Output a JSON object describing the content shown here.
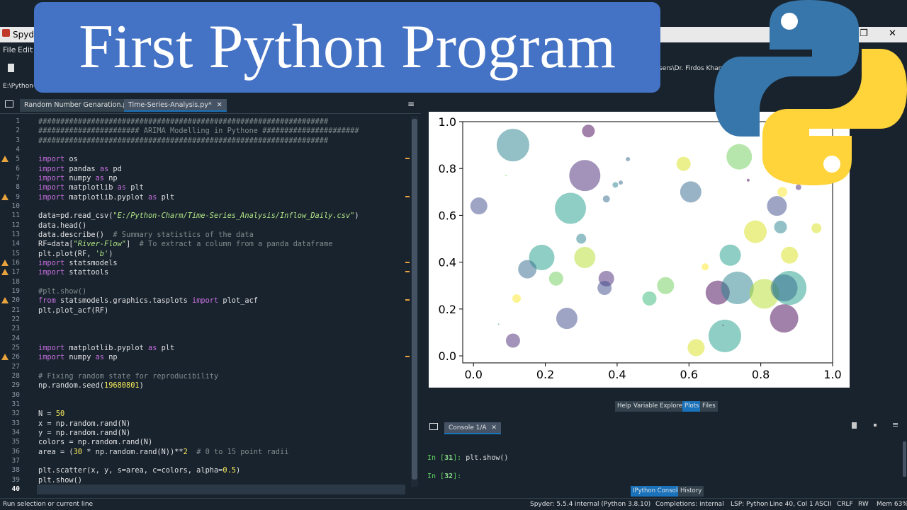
{
  "banner": {
    "title": "First Python Program"
  },
  "window": {
    "title": "Spyder",
    "minimize": "—",
    "maximize": "❐",
    "close": "✕"
  },
  "menu": {
    "items": [
      "File",
      "Edit"
    ]
  },
  "toolbar": {
    "path": "E:\\Python-C",
    "user_path": "sers\\Dr. Firdos Khan"
  },
  "editor": {
    "tabs": [
      {
        "label": "Random Number Genaration.py",
        "close": "✕"
      },
      {
        "label": "Time-Series-Analysis.py*",
        "close": "✕"
      }
    ],
    "options_icon": "≡",
    "current_line": 40,
    "warning_lines": [
      5,
      9,
      16,
      17,
      20,
      26
    ],
    "lines": [
      [
        [
          "cm",
          "##################################################################"
        ]
      ],
      [
        [
          "cm",
          "####################### ARIMA Modelling in Pythone ######################"
        ]
      ],
      [
        [
          "cm",
          "##################################################################"
        ]
      ],
      [],
      [
        [
          "kw",
          "import"
        ],
        [
          "",
          " os"
        ]
      ],
      [
        [
          "kw",
          "import"
        ],
        [
          "",
          " pandas "
        ],
        [
          "kw",
          "as"
        ],
        [
          "",
          " pd"
        ]
      ],
      [
        [
          "kw",
          "import"
        ],
        [
          "",
          " numpy "
        ],
        [
          "kw",
          "as"
        ],
        [
          "",
          " np"
        ]
      ],
      [
        [
          "kw",
          "import"
        ],
        [
          "",
          " matplotlib "
        ],
        [
          "kw",
          "as"
        ],
        [
          "",
          " plt"
        ]
      ],
      [
        [
          "kw",
          "import"
        ],
        [
          "",
          " matplotlib.pyplot "
        ],
        [
          "kw",
          "as"
        ],
        [
          "",
          " plt"
        ]
      ],
      [],
      [
        [
          "",
          "data=pd.read_csv("
        ],
        [
          "st",
          "\"E:/Python-Charm/Time-Series_Analysis/Inflow_Daily.csv\""
        ],
        [
          "",
          ")"
        ]
      ],
      [
        [
          "",
          "data.head()"
        ]
      ],
      [
        [
          "",
          "data.describe()  "
        ],
        [
          "cm",
          "# Summary statistics of the data"
        ]
      ],
      [
        [
          "",
          "RF=data["
        ],
        [
          "st",
          "\"River-Flow\""
        ],
        [
          "",
          "]  "
        ],
        [
          "cm",
          "# To extract a column from a panda dataframe"
        ]
      ],
      [
        [
          "",
          "plt.plot(RF, "
        ],
        [
          "st",
          "'b'"
        ],
        [
          "",
          ")"
        ]
      ],
      [
        [
          "kw",
          "import"
        ],
        [
          "",
          " statsmodels"
        ]
      ],
      [
        [
          "kw",
          "import"
        ],
        [
          "",
          " stattools"
        ]
      ],
      [],
      [
        [
          "cm",
          "#plt.show()"
        ]
      ],
      [
        [
          "kw",
          "from"
        ],
        [
          "",
          " statsmodels.graphics.tasplots "
        ],
        [
          "kw",
          "import"
        ],
        [
          "",
          " plot_acf"
        ]
      ],
      [
        [
          "",
          "plt.plot_acf(RF)"
        ]
      ],
      [],
      [],
      [],
      [
        [
          "kw",
          "import"
        ],
        [
          "",
          " matplotlib.pyplot "
        ],
        [
          "kw",
          "as"
        ],
        [
          "",
          " plt"
        ]
      ],
      [
        [
          "kw",
          "import"
        ],
        [
          "",
          " numpy "
        ],
        [
          "kw",
          "as"
        ],
        [
          "",
          " np"
        ]
      ],
      [],
      [
        [
          "cm",
          "# Fixing random state for reproducibility"
        ]
      ],
      [
        [
          "",
          "np.random.seed("
        ],
        [
          "num",
          "19680801"
        ],
        [
          "",
          ")"
        ]
      ],
      [],
      [],
      [
        [
          "",
          "N = "
        ],
        [
          "num",
          "50"
        ]
      ],
      [
        [
          "",
          "x = np.random.rand(N)"
        ]
      ],
      [
        [
          "",
          "y = np.random.rand(N)"
        ]
      ],
      [
        [
          "",
          "colors = np.random.rand(N)"
        ]
      ],
      [
        [
          "",
          "area = ("
        ],
        [
          "num",
          "30"
        ],
        [
          "",
          " * np.random.rand(N))**"
        ],
        [
          "num",
          "2"
        ],
        [
          "",
          "  "
        ],
        [
          "cm",
          "# 0 to 15 point radii"
        ]
      ],
      [],
      [
        [
          "",
          "plt.scatter(x, y, s=area, c=colors, alpha="
        ],
        [
          "num",
          "0.5"
        ],
        [
          "",
          ")"
        ]
      ],
      [
        [
          "",
          "plt.show()"
        ]
      ],
      []
    ]
  },
  "plots_pane": {
    "tabs": [
      "Help",
      "Variable Explorer",
      "Plots",
      "Files"
    ],
    "active_tab": "Plots"
  },
  "console": {
    "tab_label": "Console 1/A",
    "tab_close": "✕",
    "prompts": [
      {
        "prefix": "In [",
        "num": "31",
        "suffix": "]:",
        "code": " plt.show()"
      },
      {
        "prefix": "In [",
        "num": "32",
        "suffix": "]:",
        "code": ""
      }
    ],
    "tabs": [
      "IPython Console",
      "History"
    ]
  },
  "statusbar": {
    "left": "Run selection or current line",
    "items": [
      "Spyder: 5.5.4",
      "internal (Python 3.8.10)",
      "Completions: internal",
      "LSP: Python",
      "Line 40, Col 1",
      "ASCII",
      "CRLF",
      "RW",
      "Mem 63%"
    ]
  },
  "colors": {
    "bg": "#19232d",
    "banner": "#4472c4",
    "logo_blue": "#3776ab",
    "logo_yellow": "#ffd43b",
    "accent": "#1a72bb"
  },
  "chart_data": {
    "type": "scatter",
    "xlim": [
      -0.03,
      1.0
    ],
    "ylim": [
      -0.03,
      1.0
    ],
    "xticks": [
      "0.0",
      "0.2",
      "0.4",
      "0.6",
      "0.8",
      "1.0"
    ],
    "yticks": [
      "0.0",
      "0.2",
      "0.4",
      "0.6",
      "0.8",
      "1.0"
    ],
    "grid": false,
    "points": [
      {
        "x": 0.11,
        "y": 0.9,
        "r": 23,
        "color": "#26828e"
      },
      {
        "x": 0.32,
        "y": 0.96,
        "r": 9,
        "color": "#440154"
      },
      {
        "x": 0.31,
        "y": 0.77,
        "r": 22,
        "color": "#482878"
      },
      {
        "x": 0.015,
        "y": 0.64,
        "r": 12,
        "color": "#3e4a89"
      },
      {
        "x": 0.27,
        "y": 0.63,
        "r": 22,
        "color": "#1f9e89"
      },
      {
        "x": 0.19,
        "y": 0.42,
        "r": 18,
        "color": "#1f9e89"
      },
      {
        "x": 0.15,
        "y": 0.37,
        "r": 13,
        "color": "#31688e"
      },
      {
        "x": 0.3,
        "y": 0.5,
        "r": 7,
        "color": "#26828e"
      },
      {
        "x": 0.31,
        "y": 0.42,
        "r": 15,
        "color": "#b5de2b"
      },
      {
        "x": 0.23,
        "y": 0.33,
        "r": 10,
        "color": "#6ece58"
      },
      {
        "x": 0.37,
        "y": 0.33,
        "r": 11,
        "color": "#482878"
      },
      {
        "x": 0.365,
        "y": 0.29,
        "r": 10,
        "color": "#3e4a89"
      },
      {
        "x": 0.37,
        "y": 0.67,
        "r": 5,
        "color": "#31688e"
      },
      {
        "x": 0.395,
        "y": 0.73,
        "r": 4,
        "color": "#26828e"
      },
      {
        "x": 0.41,
        "y": 0.74,
        "r": 3,
        "color": "#31688e"
      },
      {
        "x": 0.43,
        "y": 0.84,
        "r": 3,
        "color": "#31688e"
      },
      {
        "x": 0.09,
        "y": 0.77,
        "r": 1,
        "color": "#6ece58"
      },
      {
        "x": 0.26,
        "y": 0.16,
        "r": 15,
        "color": "#3e4a89"
      },
      {
        "x": 0.11,
        "y": 0.065,
        "r": 10,
        "color": "#482878"
      },
      {
        "x": 0.12,
        "y": 0.245,
        "r": 6,
        "color": "#fde725"
      },
      {
        "x": 0.07,
        "y": 0.135,
        "r": 1,
        "color": "#26828e"
      },
      {
        "x": 0.49,
        "y": 0.245,
        "r": 10,
        "color": "#35b779"
      },
      {
        "x": 0.535,
        "y": 0.3,
        "r": 12,
        "color": "#6ece58"
      },
      {
        "x": 0.585,
        "y": 0.82,
        "r": 10,
        "color": "#d8e219"
      },
      {
        "x": 0.605,
        "y": 0.7,
        "r": 15,
        "color": "#31688e"
      },
      {
        "x": 0.645,
        "y": 0.38,
        "r": 5,
        "color": "#fde725"
      },
      {
        "x": 0.68,
        "y": 0.27,
        "r": 17,
        "color": "#440154"
      },
      {
        "x": 0.7,
        "y": 0.085,
        "r": 23,
        "color": "#1f9e89"
      },
      {
        "x": 0.62,
        "y": 0.035,
        "r": 12,
        "color": "#d8e219"
      },
      {
        "x": 0.735,
        "y": 0.29,
        "r": 23,
        "color": "#26828e"
      },
      {
        "x": 0.715,
        "y": 0.43,
        "r": 15,
        "color": "#1f9e89"
      },
      {
        "x": 0.74,
        "y": 0.85,
        "r": 18,
        "color": "#6ece58"
      },
      {
        "x": 0.765,
        "y": 0.75,
        "r": 2,
        "color": "#440154"
      },
      {
        "x": 0.785,
        "y": 0.53,
        "r": 16,
        "color": "#d8e219"
      },
      {
        "x": 0.81,
        "y": 0.265,
        "r": 21,
        "color": "#b5de2b"
      },
      {
        "x": 0.845,
        "y": 0.64,
        "r": 14,
        "color": "#3e4a89"
      },
      {
        "x": 0.855,
        "y": 0.55,
        "r": 9,
        "color": "#26828e"
      },
      {
        "x": 0.86,
        "y": 0.7,
        "r": 7,
        "color": "#fde725"
      },
      {
        "x": 0.88,
        "y": 0.43,
        "r": 12,
        "color": "#d8e219"
      },
      {
        "x": 0.88,
        "y": 0.29,
        "r": 24,
        "color": "#1f9e89"
      },
      {
        "x": 0.865,
        "y": 0.29,
        "r": 19,
        "color": "#31688e"
      },
      {
        "x": 0.865,
        "y": 0.16,
        "r": 20,
        "color": "#440154"
      },
      {
        "x": 0.905,
        "y": 0.72,
        "r": 4,
        "color": "#482878"
      },
      {
        "x": 0.955,
        "y": 0.545,
        "r": 7,
        "color": "#d8e219"
      },
      {
        "x": 0.695,
        "y": 0.13,
        "r": 1,
        "color": "#440154"
      }
    ]
  }
}
